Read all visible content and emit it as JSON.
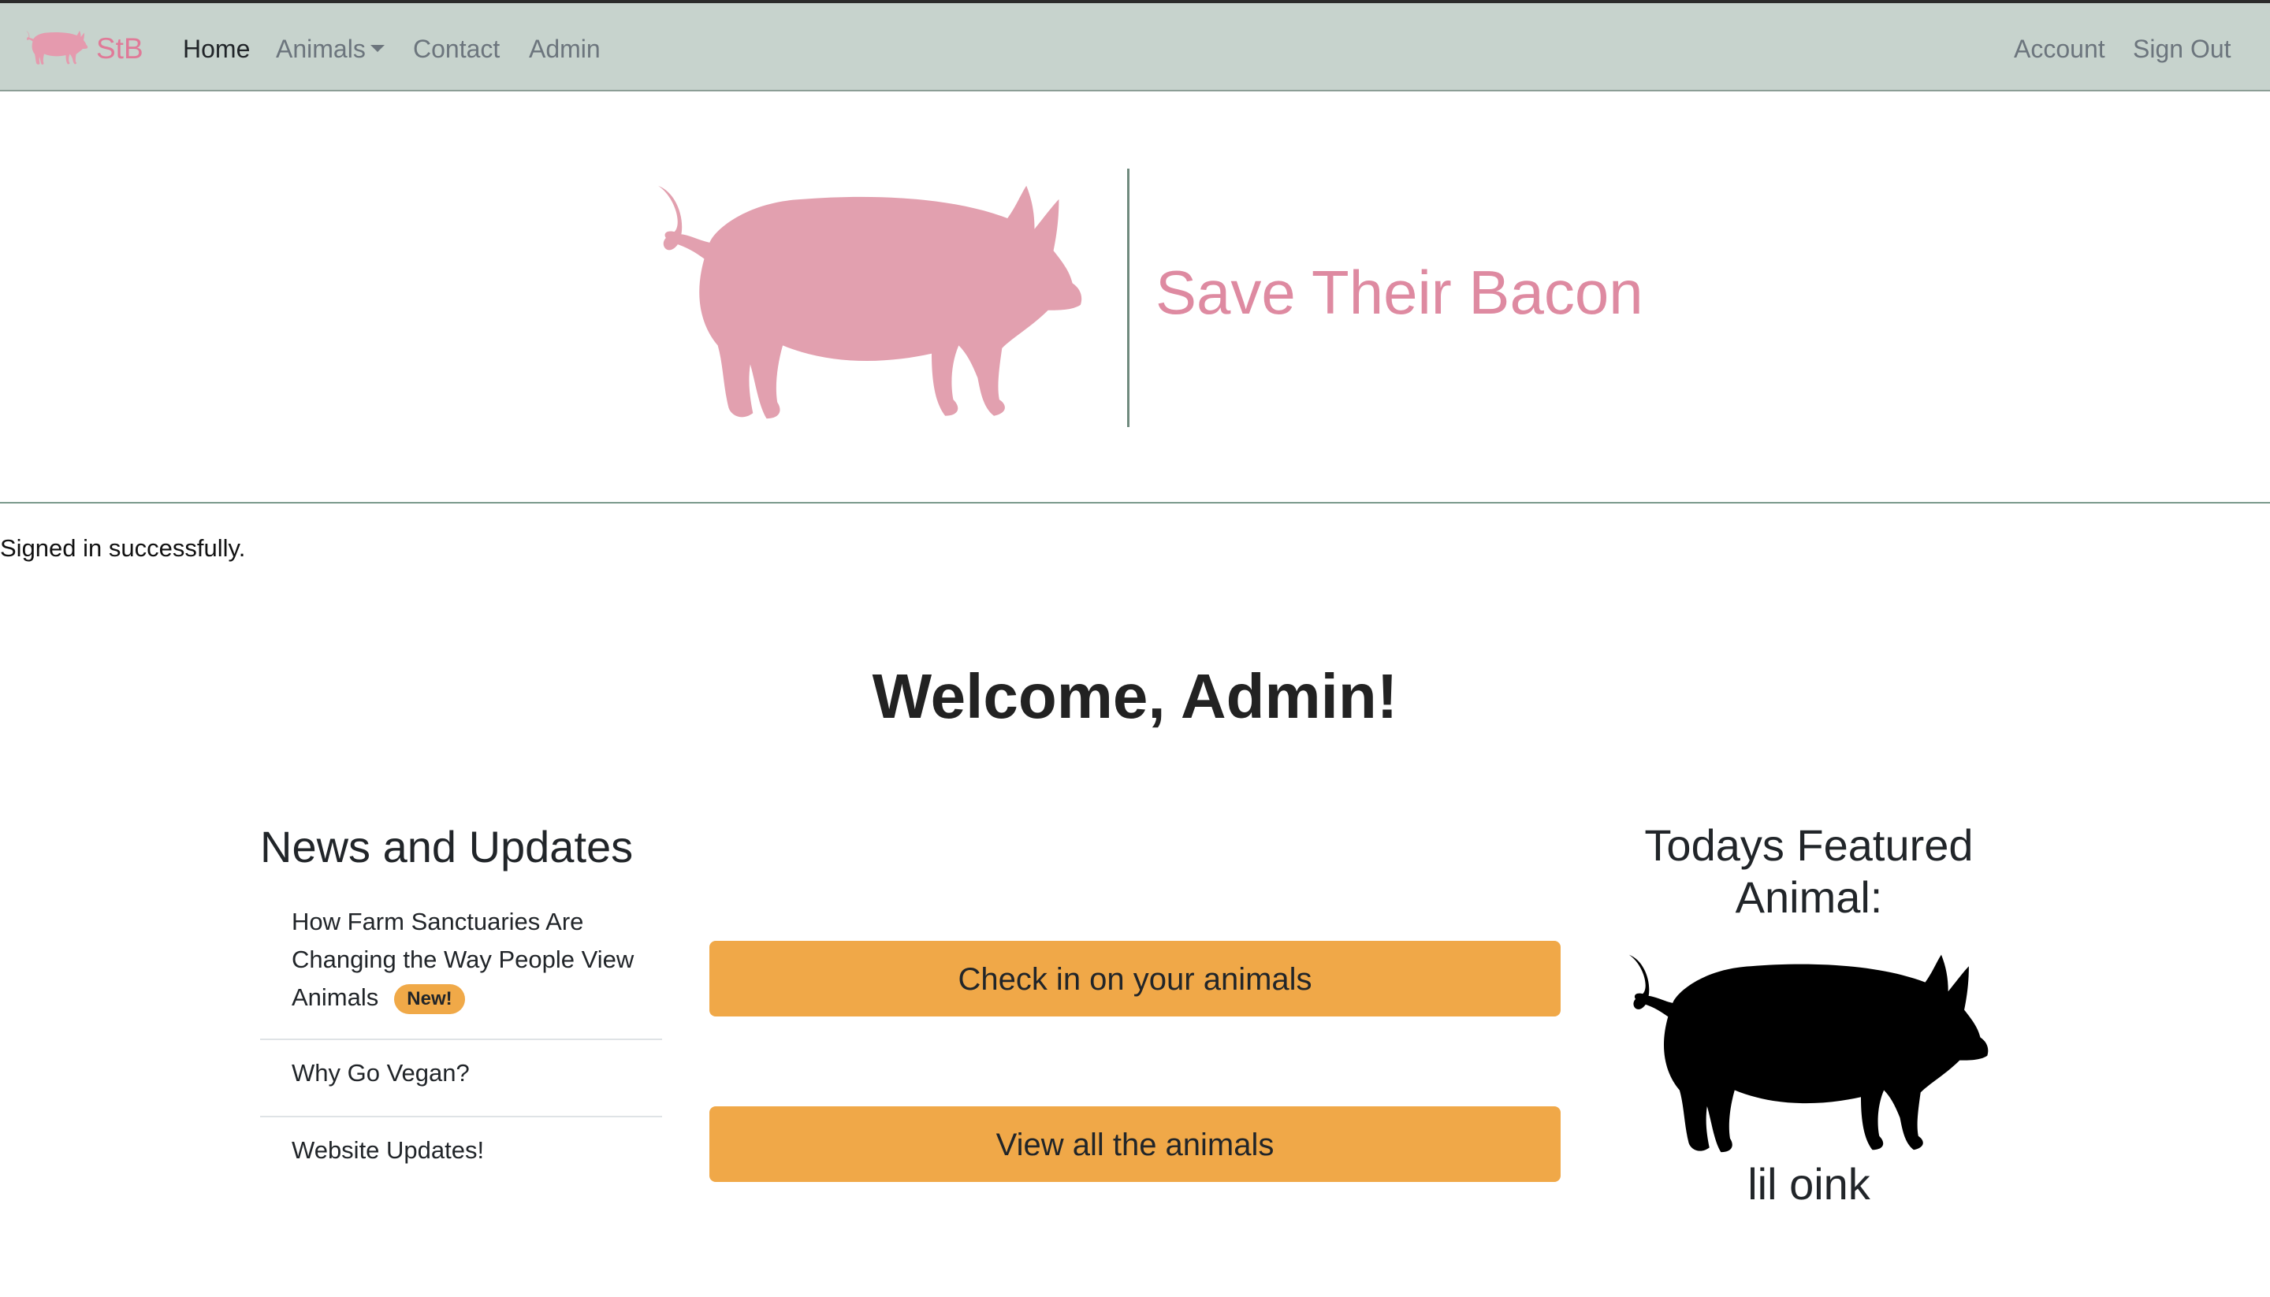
{
  "navbar": {
    "brand": "StB",
    "links": {
      "home": "Home",
      "animals": "Animals",
      "contact": "Contact",
      "admin": "Admin",
      "account": "Account",
      "sign_out": "Sign Out"
    }
  },
  "hero": {
    "title": "Save Their Bacon"
  },
  "flash": "Signed in successfully.",
  "welcome": "Welcome, Admin!",
  "news": {
    "heading": "News and Updates",
    "items": [
      {
        "label": "How Farm Sanctuaries Are Changing the Way People View Animals",
        "badge": "New!"
      },
      {
        "label": "Why Go Vegan?"
      },
      {
        "label": "Website Updates!"
      }
    ]
  },
  "actions": {
    "check_in": "Check in on your animals",
    "view_all": "View all the animals"
  },
  "featured": {
    "heading": "Todays Featured Animal:",
    "name": "lil oink"
  },
  "colors": {
    "navbar_bg": "#c7d3cd",
    "brand_pink": "#e07a98",
    "hero_pig": "#e2a0af",
    "button": "#f0a848",
    "badge": "#f0a948"
  },
  "icons": {
    "brand": "pig-icon",
    "hero": "pig-silhouette",
    "featured": "pig-silhouette"
  }
}
